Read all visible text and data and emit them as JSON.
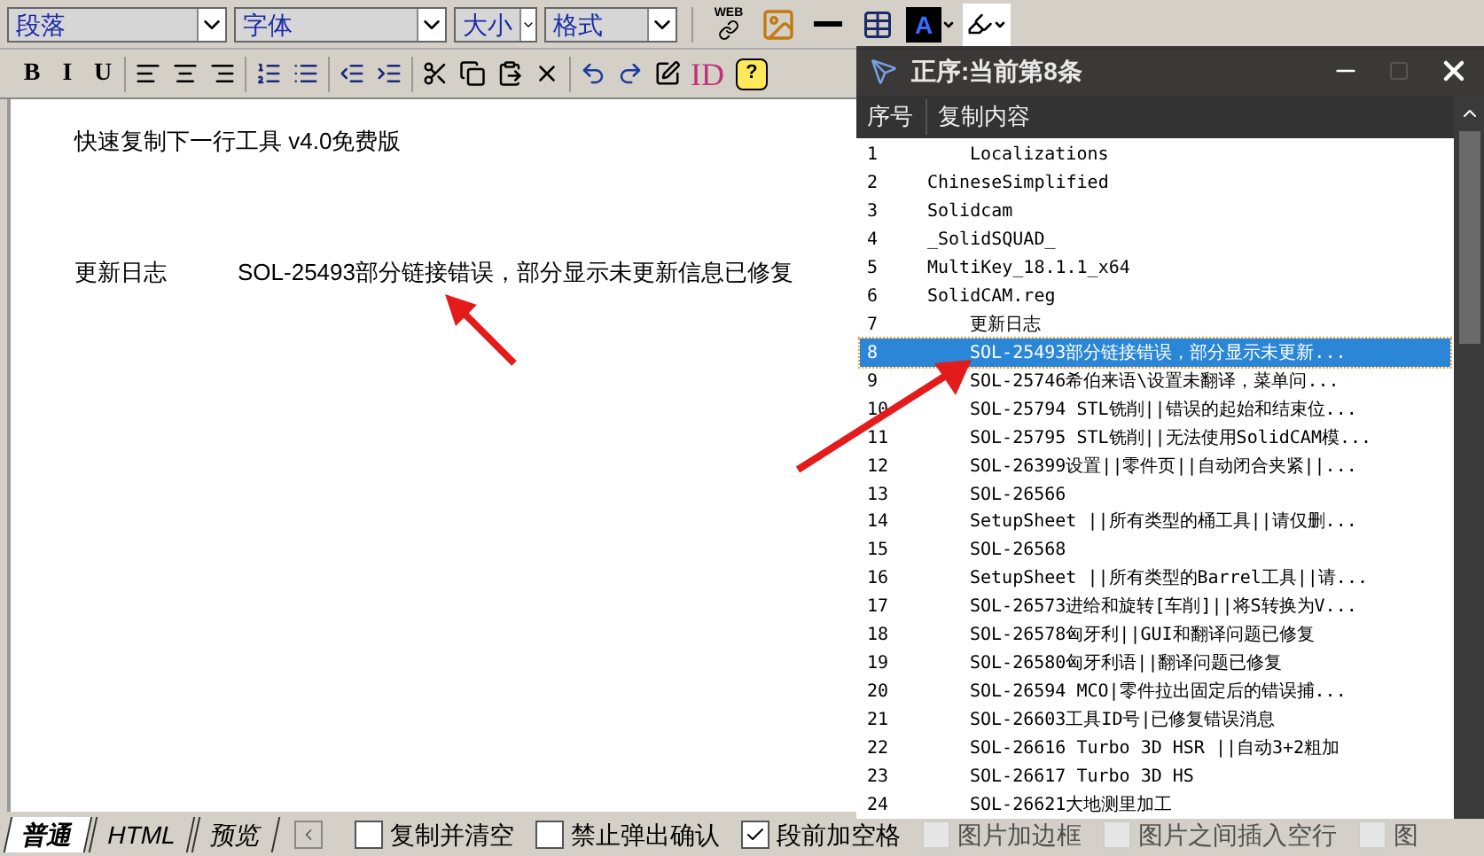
{
  "toolbar": {
    "dropdowns": [
      {
        "value": "段落"
      },
      {
        "value": "字体"
      },
      {
        "value": "大小"
      },
      {
        "value": "格式"
      }
    ],
    "insert_buttons": [
      {
        "kind": "web-link",
        "label": "WEB"
      },
      {
        "kind": "image"
      },
      {
        "kind": "rule"
      },
      {
        "kind": "table"
      },
      {
        "kind": "font-color",
        "label": "A"
      },
      {
        "kind": "highlight"
      }
    ],
    "format_buttons": [
      {
        "kind": "text",
        "label": "B"
      },
      {
        "kind": "text",
        "label": "I"
      },
      {
        "kind": "text",
        "label": "U"
      },
      {
        "kind": "sep"
      },
      {
        "kind": "align-left"
      },
      {
        "kind": "align-center"
      },
      {
        "kind": "align-right"
      },
      {
        "kind": "sep"
      },
      {
        "kind": "numbered-list"
      },
      {
        "kind": "bullet-list"
      },
      {
        "kind": "sep"
      },
      {
        "kind": "outdent"
      },
      {
        "kind": "indent"
      },
      {
        "kind": "sep"
      },
      {
        "kind": "cut"
      },
      {
        "kind": "copy"
      },
      {
        "kind": "paste"
      },
      {
        "kind": "delete"
      },
      {
        "kind": "sep"
      },
      {
        "kind": "undo"
      },
      {
        "kind": "redo"
      },
      {
        "kind": "note"
      },
      {
        "kind": "id",
        "label": "ID"
      },
      {
        "kind": "help",
        "label": "?"
      }
    ]
  },
  "editor": {
    "paragraphs": [
      {
        "text": "快速复制下一行工具 v4.0免费版"
      },
      {
        "label": "更新日志",
        "text": "SOL-25493部分链接错误，部分显示未更新信息已修复"
      }
    ]
  },
  "popup": {
    "title": "正序:当前第8条",
    "columns": [
      "序号",
      "复制内容"
    ],
    "rows": [
      {
        "number": "1",
        "content": "Localizations",
        "indented": true,
        "selected": false
      },
      {
        "number": "2",
        "content": "ChineseSimplified",
        "indented": false,
        "selected": false
      },
      {
        "number": "3",
        "content": "Solidcam",
        "indented": false,
        "selected": false
      },
      {
        "number": "4",
        "content": "_SolidSQUAD_",
        "indented": false,
        "selected": false
      },
      {
        "number": "5",
        "content": "MultiKey_18.1.1_x64",
        "indented": false,
        "selected": false
      },
      {
        "number": "6",
        "content": "SolidCAM.reg",
        "indented": false,
        "selected": false
      },
      {
        "number": "7",
        "content": "更新日志",
        "indented": true,
        "selected": false
      },
      {
        "number": "8",
        "content": "SOL-25493部分链接错误，部分显示未更新...",
        "indented": true,
        "selected": true
      },
      {
        "number": "9",
        "content": "SOL-25746希伯来语\\设置未翻译，菜单问...",
        "indented": true,
        "selected": false
      },
      {
        "number": "10",
        "content": "SOL-25794 STL铣削||错误的起始和结束位...",
        "indented": true,
        "selected": false
      },
      {
        "number": "11",
        "content": "SOL-25795 STL铣削||无法使用SolidCAM模...",
        "indented": true,
        "selected": false
      },
      {
        "number": "12",
        "content": "SOL-26399设置||零件页||自动闭合夹紧||...",
        "indented": true,
        "selected": false
      },
      {
        "number": "13",
        "content": "SOL-26566",
        "indented": true,
        "selected": false
      },
      {
        "number": "14",
        "content": "SetupSheet ||所有类型的桶工具||请仅删...",
        "indented": true,
        "selected": false
      },
      {
        "number": "15",
        "content": "SOL-26568",
        "indented": true,
        "selected": false
      },
      {
        "number": "16",
        "content": "SetupSheet ||所有类型的Barrel工具||请...",
        "indented": true,
        "selected": false
      },
      {
        "number": "17",
        "content": "SOL-26573进给和旋转[车削]||将S转换为V...",
        "indented": true,
        "selected": false
      },
      {
        "number": "18",
        "content": "SOL-26578匈牙利||GUI和翻译问题已修复",
        "indented": true,
        "selected": false
      },
      {
        "number": "19",
        "content": "SOL-26580匈牙利语||翻译问题已修复",
        "indented": true,
        "selected": false
      },
      {
        "number": "20",
        "content": "SOL-26594 MCO|零件拉出固定后的错误捕...",
        "indented": true,
        "selected": false
      },
      {
        "number": "21",
        "content": "SOL-26603工具ID号|已修复错误消息",
        "indented": true,
        "selected": false
      },
      {
        "number": "22",
        "content": "SOL-26616 Turbo 3D HSR ||自动3+2粗加",
        "indented": true,
        "selected": false
      },
      {
        "number": "23",
        "content": "SOL-26617 Turbo 3D HS",
        "indented": true,
        "selected": false
      },
      {
        "number": "24",
        "content": "SOL-26621大地测里加工",
        "indented": true,
        "selected": false
      }
    ]
  },
  "status_bar": {
    "tabs": [
      {
        "label": "普通",
        "selected": true
      },
      {
        "label": "HTML",
        "selected": false
      },
      {
        "label": "预览",
        "selected": false
      }
    ],
    "options": [
      {
        "label": "复制并清空",
        "checked": false,
        "disabled": false
      },
      {
        "label": "禁止弹出确认",
        "checked": false,
        "disabled": false
      },
      {
        "label": "段前加空格",
        "checked": true,
        "disabled": false
      },
      {
        "label": "图片加边框",
        "checked": false,
        "disabled": true
      },
      {
        "label": "图片之间插入空行",
        "checked": false,
        "disabled": true
      },
      {
        "label": "图",
        "checked": false,
        "disabled": true
      }
    ]
  }
}
